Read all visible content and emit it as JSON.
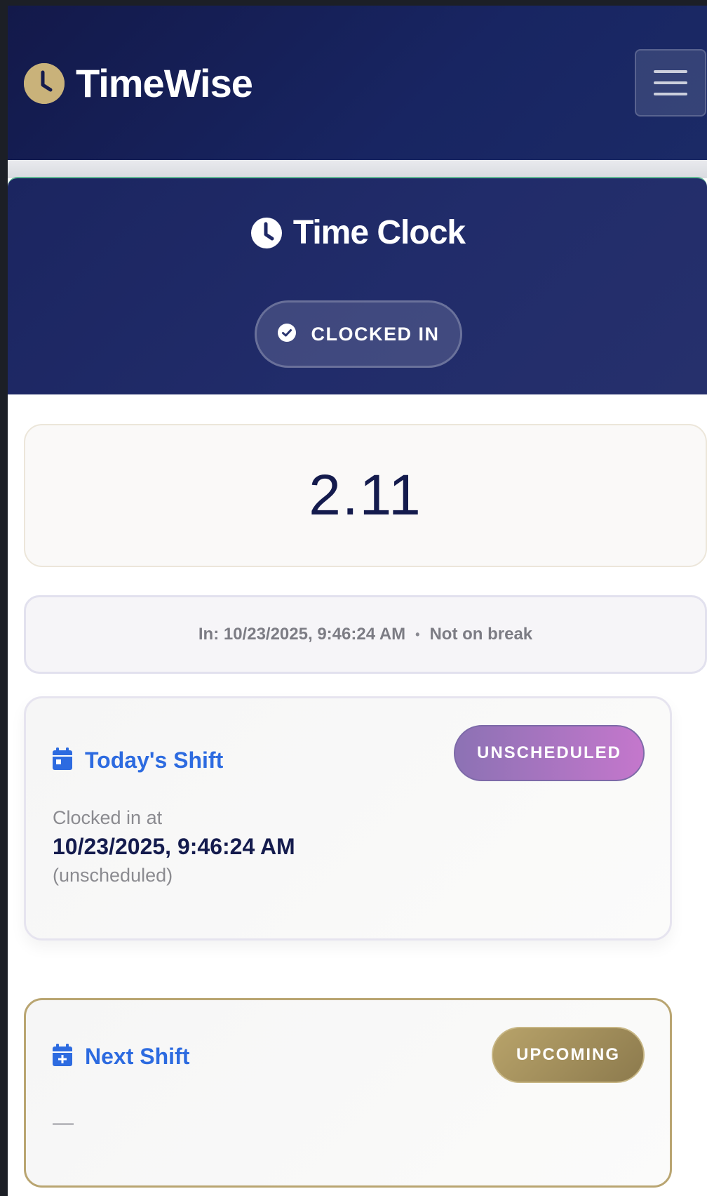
{
  "app": {
    "name": "TimeWise",
    "brand_icon": "clock-icon",
    "menu_icon": "hamburger-menu-icon"
  },
  "time_clock": {
    "title": "Time Clock",
    "status": "CLOCKED IN",
    "status_icon": "check-circle-icon",
    "elapsed": "2.11"
  },
  "session_info": {
    "in_label": "In:",
    "in_time": "10/23/2025, 9:46:24 AM",
    "separator": "•",
    "break_status": "Not on break"
  },
  "today_shift": {
    "title": "Today's Shift",
    "icon": "calendar-icon",
    "badge": "UNSCHEDULED",
    "caption": "Clocked in at",
    "time": "10/23/2025, 9:46:24 AM",
    "note": "(unscheduled)"
  },
  "next_shift": {
    "title": "Next Shift",
    "icon": "calendar-plus-icon",
    "badge": "UPCOMING",
    "value": "—"
  },
  "colors": {
    "navy": "#141b4d",
    "gold": "#c9b27a",
    "accent_blue": "#2d6be0",
    "badge_purple": "#a774c0",
    "badge_gold": "#a8955f"
  }
}
